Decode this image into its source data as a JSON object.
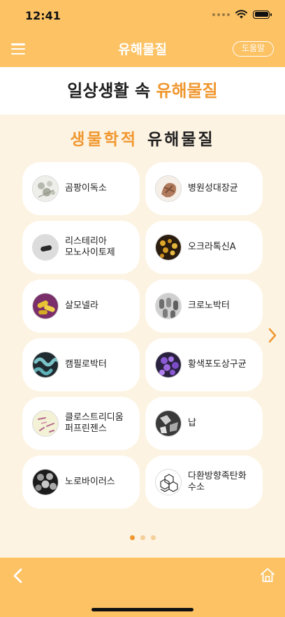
{
  "status_bar": {
    "time": "12:41"
  },
  "header": {
    "title": "유해물질",
    "help_label": "도움말"
  },
  "banner": {
    "prefix": "일상생활 속 ",
    "highlight": "유해물질"
  },
  "section": {
    "highlight": "생물학적",
    "rest": "유해물질"
  },
  "items": [
    {
      "label": "곰팡이독소",
      "icon": "mold-toxin-icon"
    },
    {
      "label": "병원성대장균",
      "icon": "pathogenic-e-coli-icon"
    },
    {
      "label": "리스테리아\n모노사이토제",
      "icon": "listeria-icon"
    },
    {
      "label": "오크라톡신A",
      "icon": "ochratoxin-a-icon"
    },
    {
      "label": "살모넬라",
      "icon": "salmonella-icon"
    },
    {
      "label": "크로노박터",
      "icon": "cronobacter-icon"
    },
    {
      "label": "캠필로박터",
      "icon": "campylobacter-icon"
    },
    {
      "label": "황색포도상구균",
      "icon": "staphylococcus-icon"
    },
    {
      "label": "클로스트리디움\n퍼프린젠스",
      "icon": "clostridium-icon"
    },
    {
      "label": "납",
      "icon": "lead-icon"
    },
    {
      "label": "노로바이러스",
      "icon": "norovirus-icon"
    },
    {
      "label": "다환방향족탄화\n수소",
      "icon": "pah-molecule-icon"
    }
  ],
  "pager": {
    "pages": 3,
    "active": 1
  },
  "colors": {
    "bar": "#fcc264",
    "accent": "#f0972f",
    "background": "#fdf3e2"
  }
}
